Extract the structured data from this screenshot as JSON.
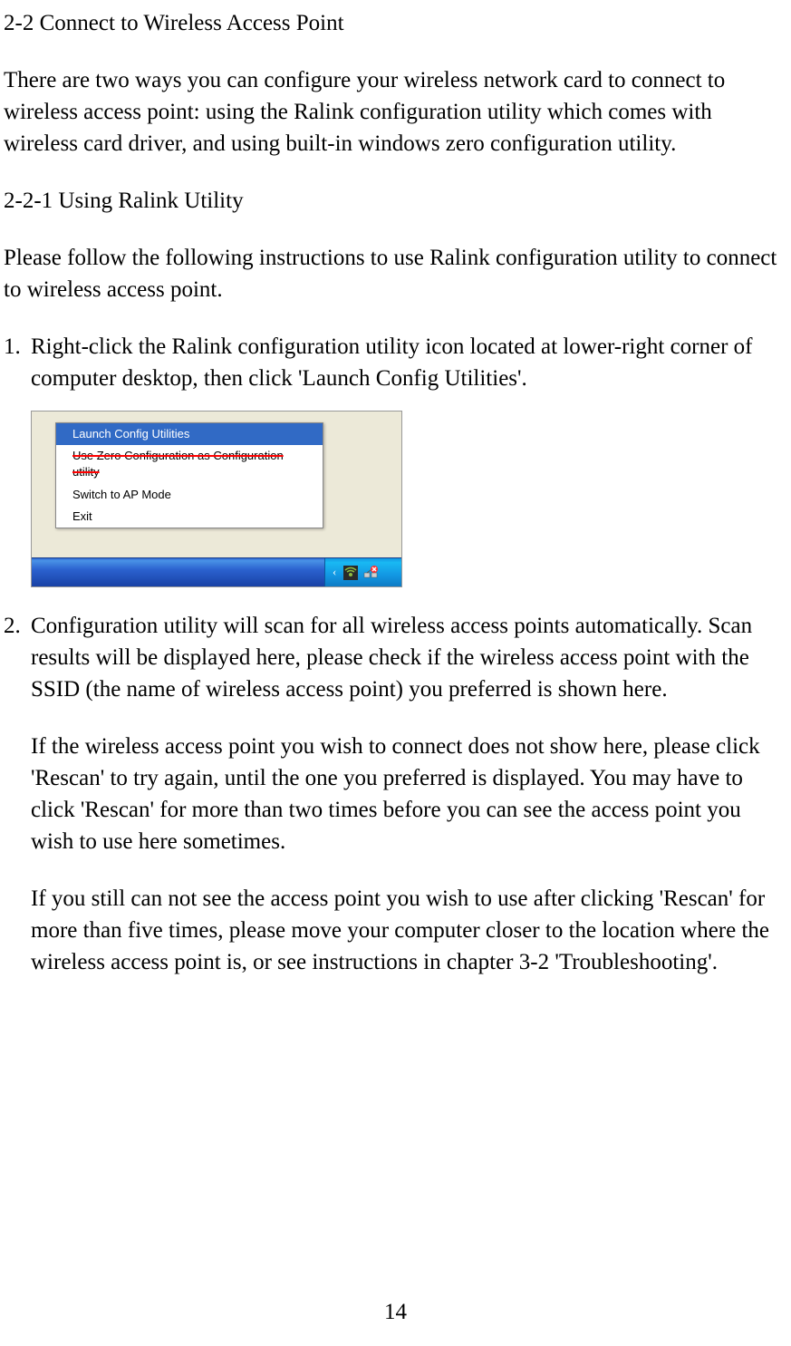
{
  "section": {
    "title": "2-2 Connect to Wireless Access Point",
    "intro": "There are two ways you can configure your wireless network card to connect to wireless access point: using the Ralink configuration utility which comes with wireless card driver, and using built-in windows zero configuration utility."
  },
  "subsection": {
    "title": "2-2-1     Using Ralink Utility",
    "intro": "Please follow the following instructions to use Ralink configuration utility to connect to wireless access point."
  },
  "steps": [
    {
      "num": "1.",
      "text": "Right-click the Ralink configuration utility icon located at lower-right corner of computer desktop, then click 'Launch Config Utilities'."
    },
    {
      "num": "2.",
      "paragraphs": [
        "Configuration utility will scan for all wireless access points automatically. Scan results will be displayed here, please check if the wireless access point with the SSID (the name of wireless access point) you preferred is shown here.",
        "If the wireless access point you wish to connect does not show here, please click 'Rescan' to try again, until the one you preferred is displayed. You may have to click 'Rescan' for more than two times before you can see the access point you wish to use here sometimes.",
        "If you still can not see the access point you wish to use after clicking 'Rescan' for more than five times, please move your computer closer to the location where the wireless access point is, or see instructions in chapter 3-2 'Troubleshooting'."
      ]
    }
  ],
  "context_menu": {
    "items": [
      "Launch Config Utilities",
      "Use Zero Configuration as Configuration utility",
      "Switch to AP Mode",
      "Exit"
    ]
  },
  "page_number": "14"
}
